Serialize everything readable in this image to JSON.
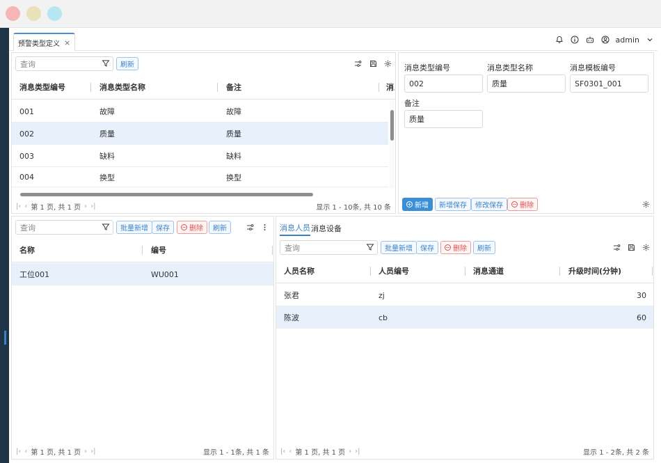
{
  "tab": {
    "label": "预警类型定义",
    "close": "×"
  },
  "header": {
    "user": "admin"
  },
  "colors": {
    "accent": "#3b82c4",
    "danger": "#d9534f",
    "selected_row": "#e8f0fb",
    "sidebar": "#1f3446"
  },
  "icons": {
    "notifications": "bell-icon",
    "info": "info-icon",
    "robot": "robot-icon",
    "user": "user-circle-icon",
    "dropdown": "chevron-down-icon",
    "filter": "filter-icon",
    "columns": "column-settings-icon",
    "save": "save-icon",
    "settings": "gear-icon",
    "more": "more-vertical-icon"
  },
  "type_list": {
    "search_placeholder": "查询",
    "refresh": "刷新",
    "columns": [
      "消息类型编号",
      "消息类型名称",
      "备注",
      "消息"
    ],
    "rows": [
      {
        "code": "001",
        "name": "故障",
        "note": "故障"
      },
      {
        "code": "002",
        "name": "质量",
        "note": "质量"
      },
      {
        "code": "003",
        "name": "缺料",
        "note": "缺料"
      },
      {
        "code": "004",
        "name": "换型",
        "note": "换型"
      }
    ],
    "selected_index": 1,
    "pager": {
      "page_text": "第 1 页, 共 1 页",
      "summary": "显示 1 - 10条, 共 10 条"
    }
  },
  "detail_form": {
    "fields": [
      {
        "label": "消息类型编号",
        "value": "002"
      },
      {
        "label": "消息类型名称",
        "value": "质量"
      },
      {
        "label": "消息模板编号",
        "value": "SF0301_001"
      },
      {
        "label": "备注",
        "value": "质量"
      }
    ],
    "buttons": {
      "add": "新增",
      "add_save": "新增保存",
      "edit_save": "修改保存",
      "delete": "删除"
    }
  },
  "station_list": {
    "search_placeholder": "查询",
    "buttons": {
      "batch_add": "批量新增",
      "save": "保存",
      "delete": "删除",
      "refresh": "刷新"
    },
    "columns": [
      "名称",
      "编号"
    ],
    "rows": [
      {
        "name": "工位001",
        "code": "WU001"
      }
    ],
    "pager": {
      "page_text": "第 1 页, 共 1 页",
      "summary": "显示 1 - 1条, 共 1 条"
    }
  },
  "message_panel": {
    "tabs": [
      "消息人员",
      "消息设备"
    ],
    "active_tab": 0,
    "search_placeholder": "查询",
    "buttons": {
      "batch_add": "批量新增",
      "save": "保存",
      "delete": "删除",
      "refresh": "刷新"
    },
    "columns": [
      "人员名称",
      "人员编号",
      "消息通道",
      "升级时间(分钟)"
    ],
    "rows": [
      {
        "name": "张君",
        "code": "zj",
        "channel": "",
        "minutes": "30"
      },
      {
        "name": "陈波",
        "code": "cb",
        "channel": "",
        "minutes": "60"
      }
    ],
    "selected_index": 1,
    "pager": {
      "page_text": "第 1 页, 共 1 页",
      "summary": "显示 1 - 2条, 共 2 条"
    }
  }
}
